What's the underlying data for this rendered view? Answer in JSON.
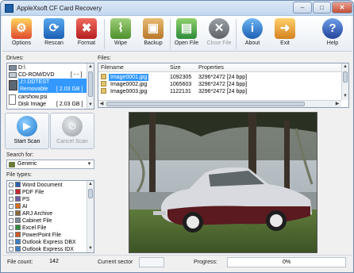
{
  "window": {
    "title": "AppleXsoft CF Card Recovery",
    "minimize_glyph": "–",
    "maximize_glyph": "□",
    "close_glyph": "✕"
  },
  "toolbar": {
    "options": "Options",
    "rescan": "Rescan",
    "format": "Format",
    "wipe": "Wipe",
    "backup": "Backup",
    "open_file": "Open File",
    "close_file": "Close File",
    "about": "About",
    "exit": "Exit",
    "help": "Help"
  },
  "drives": {
    "label": "Drives:",
    "items": [
      {
        "name": "D:\\",
        "size": ""
      },
      {
        "name": "CD-ROM/DVD",
        "size": "[ - - ]"
      },
      {
        "name": "J:\\ DDTEST",
        "size": ""
      },
      {
        "name": "Removable",
        "size": "[ 2.03 GB ]"
      },
      {
        "name": "carshow.psi",
        "size": ""
      },
      {
        "name": "Disk Image",
        "size": "[ 2.03 GB ]"
      }
    ]
  },
  "files": {
    "label": "Files:",
    "columns": {
      "filename": "Filename",
      "size": "Size",
      "properties": "Properties"
    },
    "rows": [
      {
        "name": "Image0001.jpg",
        "size": "1092305",
        "props": "3296*2472 [24 bpp]"
      },
      {
        "name": "Image0002.jpg",
        "size": "1065603",
        "props": "3296*2472 [24 bpp]"
      },
      {
        "name": "Image0003.jpg",
        "size": "1122131",
        "props": "3296*2472 [24 bpp]"
      }
    ]
  },
  "scan": {
    "start": "Start Scan",
    "cancel": "Cancel Scan"
  },
  "search": {
    "label": "Search for:",
    "value": "Generic"
  },
  "file_types": {
    "label": "File types:",
    "items": [
      {
        "name": "Word Document",
        "color": "#2b5fb4"
      },
      {
        "name": "PDF File",
        "color": "#c8282d"
      },
      {
        "name": "PS",
        "color": "#6a5fa8"
      },
      {
        "name": "AI",
        "color": "#d96d1f"
      },
      {
        "name": "ARJ Archive",
        "color": "#8c6b3a"
      },
      {
        "name": "Cabinet File",
        "color": "#7d8c9a"
      },
      {
        "name": "Excel File",
        "color": "#2e8b3c"
      },
      {
        "name": "PowerPoint File",
        "color": "#d2572a"
      },
      {
        "name": "Outlook Express DBX",
        "color": "#3d7fc6"
      },
      {
        "name": "Outlook Express IDX",
        "color": "#3d7fc6"
      }
    ]
  },
  "status": {
    "file_count_label": "File count:",
    "file_count": "142",
    "current_sector_label": "Current sector",
    "current_sector": "",
    "progress_label": "Progress:",
    "progress": "0%",
    "progress_value": 0
  },
  "colors": {
    "selection": "#3399ff",
    "start_scan": "#3fa0e6",
    "cancel_scan": "#b9bec5"
  }
}
